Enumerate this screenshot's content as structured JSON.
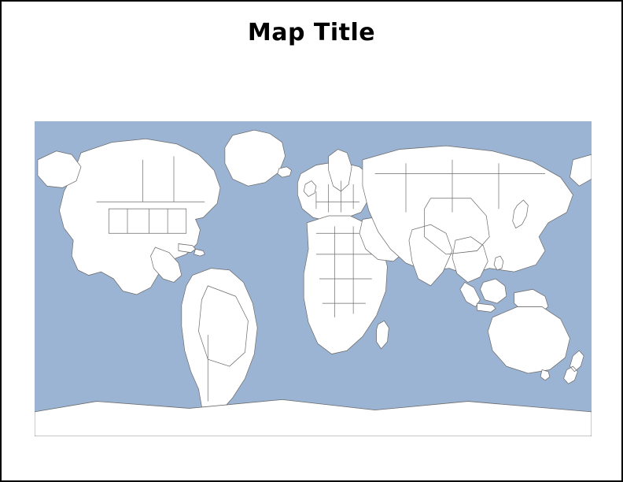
{
  "title": "Map Title",
  "map": {
    "projection": "equirectangular",
    "ocean_color": "#9cb4d4",
    "land_fill": "#ffffff",
    "land_stroke": "#6a6a6a",
    "extent_lon": [
      -180,
      180
    ],
    "extent_lat": [
      -90,
      90
    ],
    "country_borders": true
  }
}
